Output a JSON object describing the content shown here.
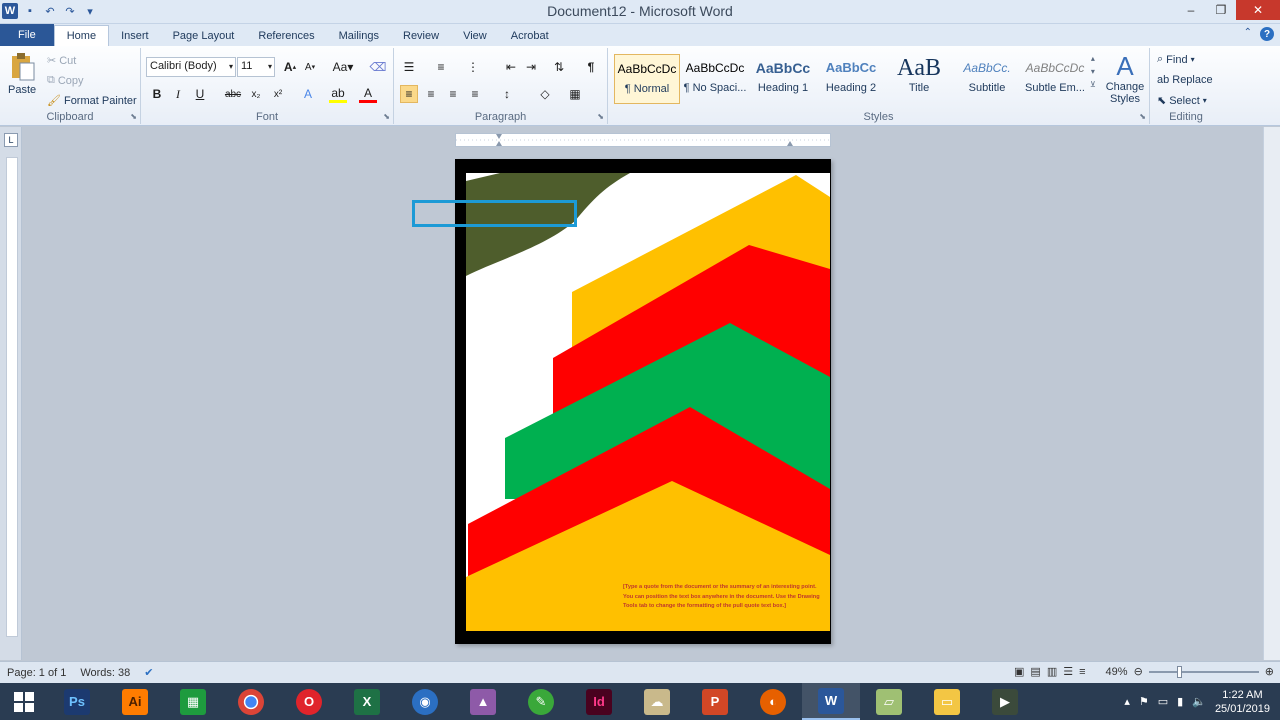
{
  "window": {
    "title": "Document12 - Microsoft Word"
  },
  "tabs": [
    "File",
    "Home",
    "Insert",
    "Page Layout",
    "References",
    "Mailings",
    "Review",
    "View",
    "Acrobat"
  ],
  "clipboard": {
    "paste": "Paste",
    "cut": "Cut",
    "copy": "Copy",
    "format_painter": "Format Painter",
    "label": "Clipboard"
  },
  "font": {
    "name": "Calibri (Body)",
    "size": "11",
    "label": "Font"
  },
  "paragraph": {
    "label": "Paragraph"
  },
  "styles": {
    "label": "Styles",
    "items": [
      {
        "preview": "AaBbCcDc",
        "name": "¶ Normal"
      },
      {
        "preview": "AaBbCcDc",
        "name": "¶ No Spaci..."
      },
      {
        "preview": "AaBbCc",
        "name": "Heading 1"
      },
      {
        "preview": "AaBbCc",
        "name": "Heading 2"
      },
      {
        "preview": "AaB",
        "name": "Title"
      },
      {
        "preview": "AaBbCc.",
        "name": "Subtitle"
      },
      {
        "preview": "AaBbCcDc",
        "name": "Subtle Em..."
      }
    ],
    "change_styles": "Change Styles"
  },
  "editing": {
    "label": "Editing",
    "find": "Find",
    "replace": "Replace",
    "select": "Select"
  },
  "document": {
    "quote": "[Type a quote from the document or the summary of an interesting point. You can position the text box anywhere in the document. Use the Drawing Tools tab to change the formatting of the pull quote text box.]",
    "colors": {
      "olive": "#4e5d2c",
      "yellow": "#ffc000",
      "red": "#ff0000",
      "green": "#00b050"
    }
  },
  "status": {
    "page": "Page: 1 of 1",
    "words": "Words: 38",
    "zoom": "49%"
  },
  "clock": {
    "time": "1:22 AM",
    "date": "25/01/2019"
  },
  "taskbar_apps": [
    "Ps",
    "Ai",
    "Id"
  ]
}
